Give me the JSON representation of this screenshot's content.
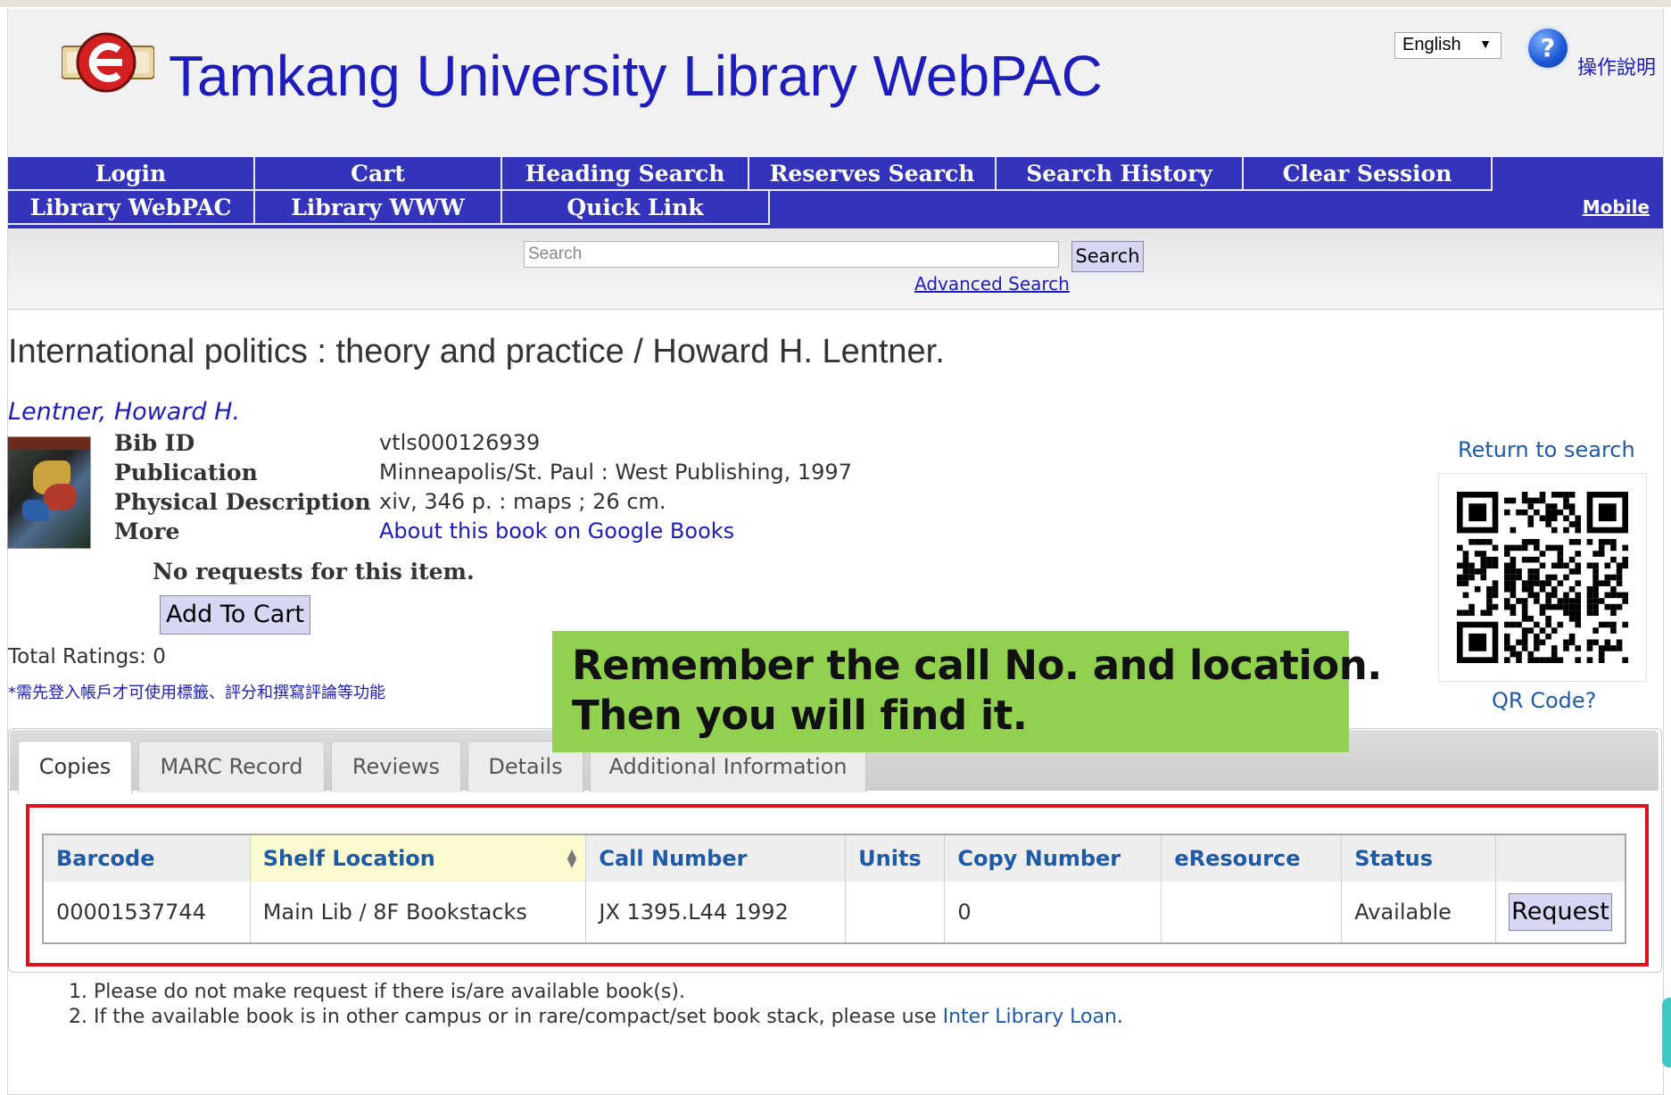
{
  "header": {
    "title": "Tamkang University Library WebPAC",
    "language": "English",
    "help_label": "操作說明"
  },
  "nav": {
    "row1": [
      "Login",
      "Cart",
      "Heading Search",
      "Reserves Search",
      "Search History",
      "Clear Session"
    ],
    "row2": [
      "Library WebPAC",
      "Library WWW",
      "Quick Link"
    ],
    "mobile": "Mobile"
  },
  "search": {
    "placeholder": "Search",
    "button": "Search",
    "advanced": "Advanced Search"
  },
  "record": {
    "title": "International politics : theory and practice / Howard H. Lentner.",
    "author": "Lentner, Howard H.",
    "fields": [
      {
        "label": "Bib ID",
        "value": "vtls000126939"
      },
      {
        "label": "Publication",
        "value": "Minneapolis/St. Paul : West Publishing, 1997"
      },
      {
        "label": "Physical Description",
        "value": "xiv, 346 p. : maps ; 26 cm."
      },
      {
        "label": "More",
        "value": "About this book on Google Books"
      }
    ],
    "no_requests": "No requests for this item.",
    "add_to_cart": "Add To Cart",
    "ratings": "Total Ratings: 0",
    "login_note": "*需先登入帳戶才可使用標籤、評分和撰寫評論等功能"
  },
  "side": {
    "return_link": "Return to search",
    "qr_link": "QR Code?"
  },
  "callout": {
    "line1": "Remember the call No. and location.",
    "line2": "Then you will find it."
  },
  "tabs": [
    "Copies",
    "MARC Record",
    "Reviews",
    "Details",
    "Additional Information"
  ],
  "copies_table": {
    "headers": [
      "Barcode",
      "Shelf Location",
      "Call Number",
      "Units",
      "Copy Number",
      "eResource",
      "Status",
      ""
    ],
    "rows": [
      {
        "barcode": "00001537744",
        "shelf": "Main Lib / 8F Bookstacks",
        "call": "JX 1395.L44 1992",
        "units": "",
        "copy": "0",
        "eres": "",
        "status": "Available",
        "action": "Request"
      }
    ]
  },
  "notes": {
    "line1": "1. Please do not make request if there is/are available book(s).",
    "line2_prefix": "2. If the available book is in other campus or in rare/compact/set book stack, please use ",
    "line2_link": "Inter Library Loan",
    "line2_suffix": "."
  },
  "colors": {
    "nav": "#3333bb",
    "title": "#1d1dbd",
    "callout": "#92d050",
    "highlight_frame": "#e0101a",
    "button": "#d7d7f4"
  }
}
